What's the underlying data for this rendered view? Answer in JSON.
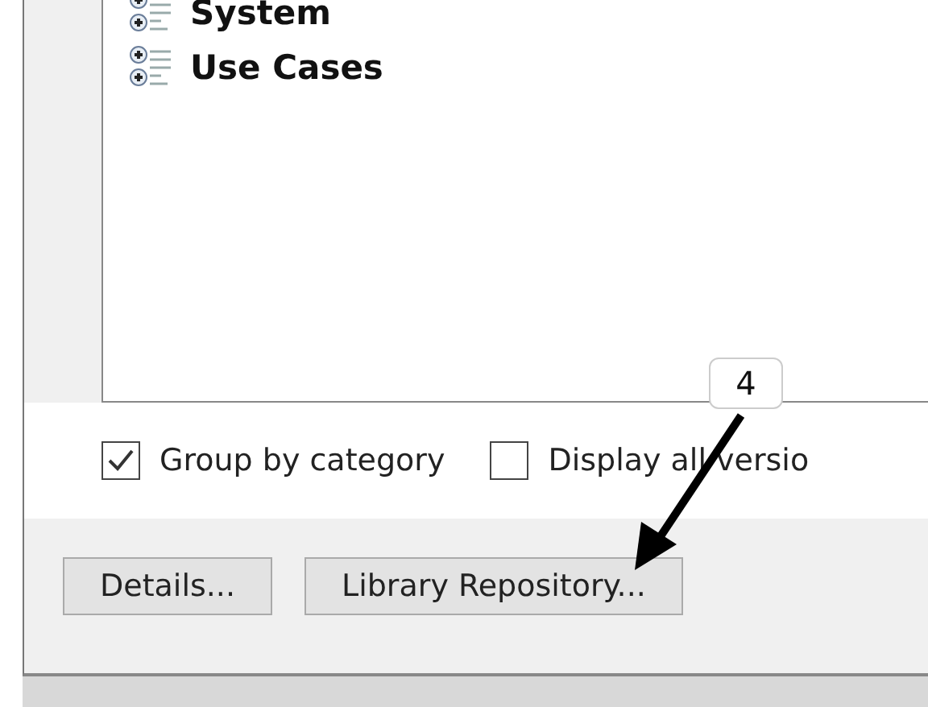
{
  "tree": {
    "items": [
      {
        "label": "System",
        "expanded": false
      },
      {
        "label": "Use Cases",
        "expanded": false
      }
    ]
  },
  "options": [
    {
      "label": "Group by category",
      "checked": true
    },
    {
      "label": "Display all versio",
      "checked": false
    }
  ],
  "buttons": [
    {
      "label": "Details..."
    },
    {
      "label": "Library Repository..."
    }
  ],
  "callout": {
    "label": "4"
  }
}
